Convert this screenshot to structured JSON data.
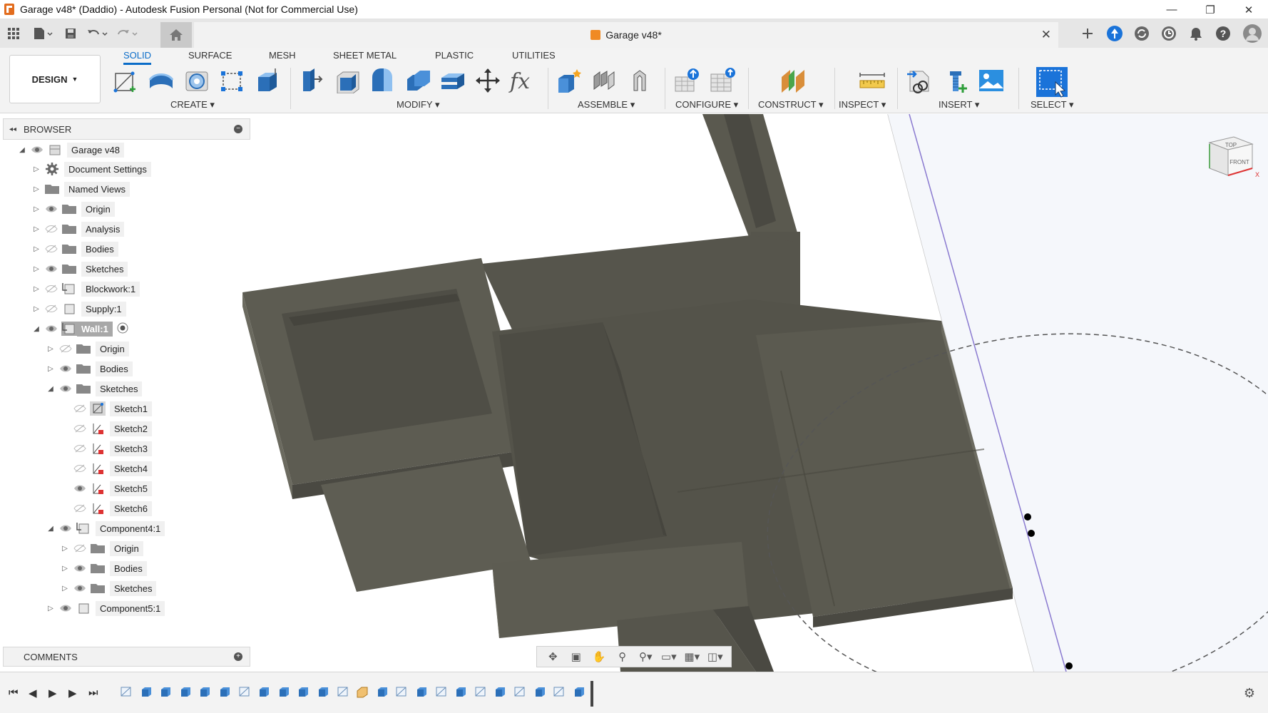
{
  "window": {
    "title": "Garage v48* (Daddio) - Autodesk Fusion Personal (Not for Commercial Use)",
    "controls": {
      "minimize": "—",
      "restore": "❐",
      "close": "✕"
    }
  },
  "document_tab": {
    "title": "Garage v48*",
    "close": "✕"
  },
  "toolbar": {
    "workspace": "DESIGN",
    "tabs": [
      "SOLID",
      "SURFACE",
      "MESH",
      "SHEET METAL",
      "PLASTIC",
      "UTILITIES"
    ],
    "active_tab": "SOLID",
    "groups": [
      "CREATE",
      "MODIFY",
      "ASSEMBLE",
      "CONFIGURE",
      "CONSTRUCT",
      "INSPECT",
      "INSERT",
      "SELECT"
    ]
  },
  "browser": {
    "header": "BROWSER",
    "items": [
      {
        "label": "Garage v48"
      },
      {
        "label": "Document Settings"
      },
      {
        "label": "Named Views"
      },
      {
        "label": "Origin"
      },
      {
        "label": "Analysis"
      },
      {
        "label": "Bodies"
      },
      {
        "label": "Sketches"
      },
      {
        "label": "Blockwork:1"
      },
      {
        "label": "Supply:1"
      },
      {
        "label": "Wall:1"
      },
      {
        "label": "Origin"
      },
      {
        "label": "Bodies"
      },
      {
        "label": "Sketches"
      },
      {
        "label": "Sketch1"
      },
      {
        "label": "Sketch2"
      },
      {
        "label": "Sketch3"
      },
      {
        "label": "Sketch4"
      },
      {
        "label": "Sketch5"
      },
      {
        "label": "Sketch6"
      },
      {
        "label": "Component4:1"
      },
      {
        "label": "Origin"
      },
      {
        "label": "Bodies"
      },
      {
        "label": "Sketches"
      },
      {
        "label": "Component5:1"
      }
    ]
  },
  "comments": {
    "header": "COMMENTS"
  },
  "viewcube": {
    "top": "TOP",
    "front": "FRONT"
  },
  "colors": {
    "accent": "#0a6cc8",
    "model": "#5d5c52",
    "model_dark": "#4c4b43",
    "model_light": "#6c6b60"
  }
}
